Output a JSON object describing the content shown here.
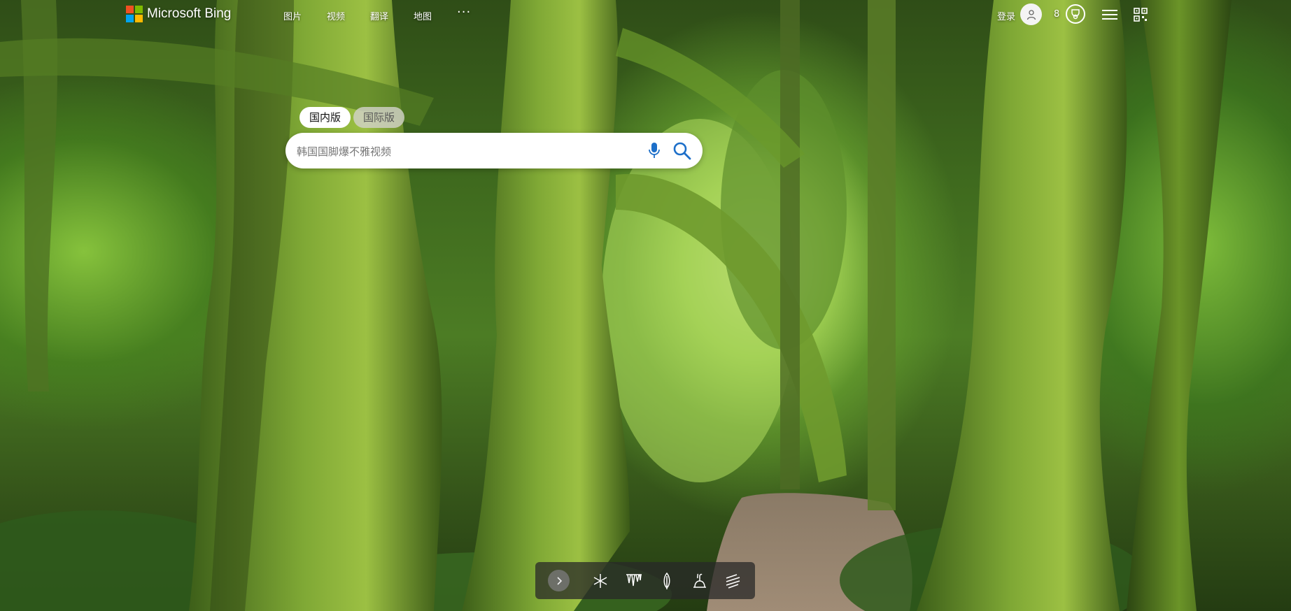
{
  "brand": {
    "name": "Microsoft Bing",
    "logo_colors": [
      "#f25022",
      "#7fba00",
      "#00a4ef",
      "#ffb900"
    ]
  },
  "nav": {
    "items": [
      {
        "label": "图片"
      },
      {
        "label": "视频"
      },
      {
        "label": "翻译"
      },
      {
        "label": "地图"
      }
    ],
    "more_label": "···"
  },
  "user": {
    "login_label": "登录",
    "avatar_icon": "user-icon",
    "points": "8",
    "rewards_icon": "rewards-trophy-icon"
  },
  "toolbar_icons": {
    "menu": "hamburger-menu-icon",
    "qr": "qr-code-icon"
  },
  "search": {
    "tabs": [
      {
        "label": "国内版",
        "active": true
      },
      {
        "label": "国际版",
        "active": false
      }
    ],
    "placeholder": "韩国国脚爆不雅视频",
    "mic_icon": "microphone-icon",
    "search_icon": "search-icon"
  },
  "bottom_bar": {
    "icons": [
      "chevron-right-icon",
      "snowflake-icon",
      "icicles-icon",
      "feather-icon",
      "teapot-icon",
      "wind-icon"
    ]
  },
  "colors": {
    "text_on_image": "#ffffff",
    "tab_active_bg": "#ffffff",
    "tab_inactive_bg": "#d2d2c8"
  }
}
